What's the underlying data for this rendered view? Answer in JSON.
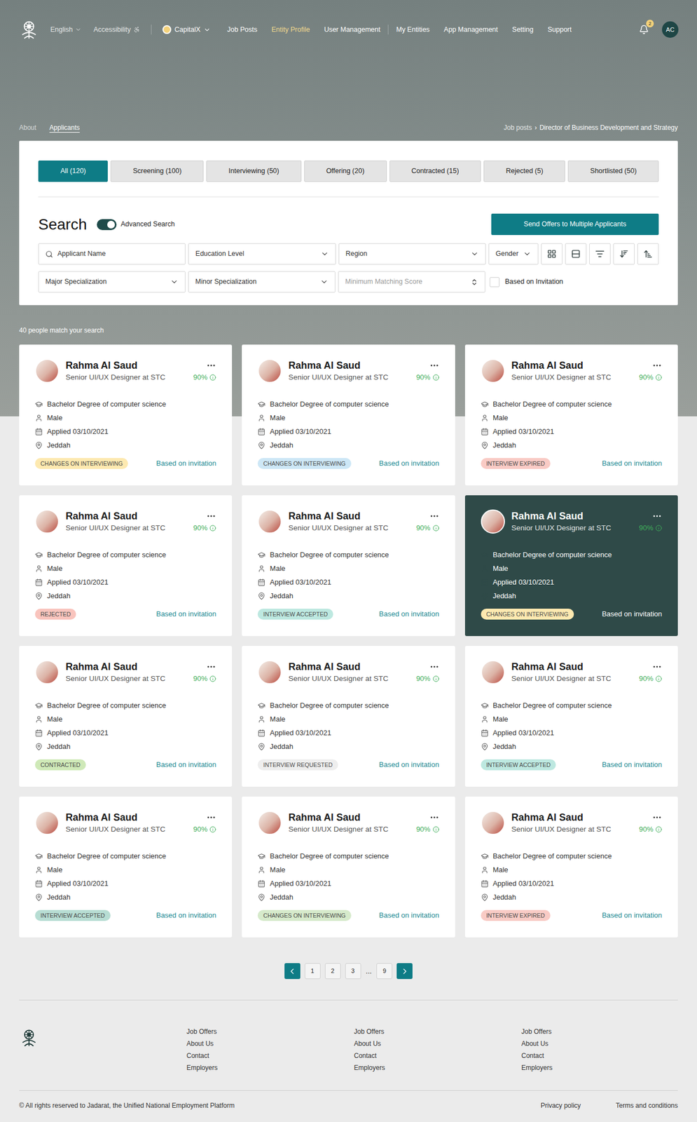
{
  "nav": {
    "language": "English",
    "accessibility": "Accessibility",
    "entity": "CapitalX",
    "entity_items": [
      {
        "label": "Job Posts",
        "selected": false
      },
      {
        "label": "Entity Profile",
        "selected": true
      },
      {
        "label": "User Management",
        "selected": false
      }
    ],
    "account_items": [
      {
        "label": "My Entities",
        "selected": false
      },
      {
        "label": "App Management",
        "selected": false
      },
      {
        "label": "Setting",
        "selected": false
      },
      {
        "label": "Support",
        "selected": false
      }
    ],
    "notifications": "2",
    "avatar": "AC"
  },
  "subnav": [
    {
      "label": "About",
      "selected": false
    },
    {
      "label": "Applicants",
      "selected": true
    }
  ],
  "breadcrumb": {
    "items": [
      "Job posts",
      "Director of Business Development and Strategy"
    ],
    "separator": "›"
  },
  "tabs": [
    {
      "label": "All (120)",
      "selected": true
    },
    {
      "label": "Screening (100)",
      "selected": false
    },
    {
      "label": "Interviewing (50)",
      "selected": false
    },
    {
      "label": "Offering (20)",
      "selected": false
    },
    {
      "label": "Contracted (15)",
      "selected": false
    },
    {
      "label": "Rejected (5)",
      "selected": false
    },
    {
      "label": "Shortlisted (50)",
      "selected": false
    }
  ],
  "search": {
    "title": "Search",
    "advanced": {
      "label": "Advanced Search",
      "on": true
    },
    "send_button": "Send Offers to Multiple Applicants",
    "name_placeholder": "Applicant Name",
    "selects_row1": [
      "Education Level",
      "Region"
    ],
    "gender": "Gender",
    "selects_row2": [
      "Major Specialization",
      "Minor Specialization"
    ],
    "score_placeholder": "Minimum Matching Score",
    "invitation_checkbox": {
      "label": "Based on Invitation",
      "checked": false
    }
  },
  "results_count": "40 people match your search",
  "applicants": [
    {
      "name": "Rahma Al Saud",
      "title": "Senior UI/UX Designer at STC",
      "score": "90%",
      "education": "Bachelor Degree of computer science",
      "gender": "Male",
      "applied": "Applied 03/10/2021",
      "city": "Jeddah",
      "status": "CHANGES ON INTERVIEWING",
      "color": "#fde9b0",
      "invitation": "Based on invitation",
      "selected": false
    },
    {
      "name": "Rahma Al Saud",
      "title": "Senior UI/UX Designer at STC",
      "score": "90%",
      "education": "Bachelor Degree of computer science",
      "gender": "Male",
      "applied": "Applied 03/10/2021",
      "city": "Jeddah",
      "status": "CHANGES ON INTERVIEWING",
      "color": "#cde7f6",
      "invitation": "Based on invitation",
      "selected": false
    },
    {
      "name": "Rahma Al Saud",
      "title": "Senior UI/UX Designer at STC",
      "score": "90%",
      "education": "Bachelor Degree of computer science",
      "gender": "Male",
      "applied": "Applied 03/10/2021",
      "city": "Jeddah",
      "status": "INTERVIEW EXPIRED",
      "color": "#f9cbc5",
      "invitation": "Based on invitation",
      "selected": false
    },
    {
      "name": "Rahma Al Saud",
      "title": "Senior UI/UX Designer at STC",
      "score": "90%",
      "education": "Bachelor Degree of computer science",
      "gender": "Male",
      "applied": "Applied 03/10/2021",
      "city": "Jeddah",
      "status": "REJECTED",
      "color": "#f9c4bd",
      "invitation": "Based on invitation",
      "selected": false
    },
    {
      "name": "Rahma Al Saud",
      "title": "Senior UI/UX Designer at STC",
      "score": "90%",
      "education": "Bachelor Degree of computer science",
      "gender": "Male",
      "applied": "Applied 03/10/2021",
      "city": "Jeddah",
      "status": "INTERVIEW ACCEPTED",
      "color": "#bde8e0",
      "invitation": "Based on invitation",
      "selected": false
    },
    {
      "name": "Rahma Al Saud",
      "title": "Senior UI/UX Designer at STC",
      "score": "90%",
      "education": "Bachelor Degree of computer science",
      "gender": "Male",
      "applied": "Applied 03/10/2021",
      "city": "Jeddah",
      "status": "CHANGES ON INTERVIEWING",
      "color": "#fde9b0",
      "invitation": "Based on invitation",
      "selected": true
    },
    {
      "name": "Rahma Al Saud",
      "title": "Senior UI/UX Designer at STC",
      "score": "90%",
      "education": "Bachelor Degree of computer science",
      "gender": "Male",
      "applied": "Applied 03/10/2021",
      "city": "Jeddah",
      "status": "CONTRACTED",
      "color": "#cfe9b8",
      "invitation": "Based on invitation",
      "selected": false
    },
    {
      "name": "Rahma Al Saud",
      "title": "Senior UI/UX Designer at STC",
      "score": "90%",
      "education": "Bachelor Degree of computer science",
      "gender": "Male",
      "applied": "Applied 03/10/2021",
      "city": "Jeddah",
      "status": "INTERVIEW REQUESTED",
      "color": "#eeeeee",
      "invitation": "Based on invitation",
      "selected": false
    },
    {
      "name": "Rahma Al Saud",
      "title": "Senior UI/UX Designer at STC",
      "score": "90%",
      "education": "Bachelor Degree of computer science",
      "gender": "Male",
      "applied": "Applied 03/10/2021",
      "city": "Jeddah",
      "status": "INTERVIEW ACCEPTED",
      "color": "#bde8e0",
      "invitation": "Based on invitation",
      "selected": false
    },
    {
      "name": "Rahma Al Saud",
      "title": "Senior UI/UX Designer at STC",
      "score": "90%",
      "education": "Bachelor Degree of computer science",
      "gender": "Male",
      "applied": "Applied 03/10/2021",
      "city": "Jeddah",
      "status": "INTERVIEW ACCEPTED",
      "color": "#b7ddd3",
      "invitation": "Based on invitation",
      "selected": false
    },
    {
      "name": "Rahma Al Saud",
      "title": "Senior UI/UX Designer at STC",
      "score": "90%",
      "education": "Bachelor Degree of computer science",
      "gender": "Male",
      "applied": "Applied 03/10/2021",
      "city": "Jeddah",
      "status": "CHANGES ON INTERVIEWING",
      "color": "#d6eacb",
      "invitation": "Based on invitation",
      "selected": false
    },
    {
      "name": "Rahma Al Saud",
      "title": "Senior UI/UX Designer at STC",
      "score": "90%",
      "education": "Bachelor Degree of computer science",
      "gender": "Male",
      "applied": "Applied 03/10/2021",
      "city": "Jeddah",
      "status": "INTERVIEW EXPIRED",
      "color": "#f9cbc5",
      "invitation": "Based on invitation",
      "selected": false
    }
  ],
  "pagination": {
    "pages": [
      {
        "label": "1",
        "kind": "page",
        "selected": false
      },
      {
        "label": "2",
        "kind": "page",
        "selected": false
      },
      {
        "label": "3",
        "kind": "page",
        "selected": false
      },
      {
        "label": "...",
        "kind": "ellipsis",
        "selected": false
      },
      {
        "label": "9",
        "kind": "page",
        "selected": false
      }
    ]
  },
  "footer": {
    "columns": [
      [
        "Job Offers",
        "About Us",
        "Contact",
        "Employers"
      ],
      [
        "Job Offers",
        "About Us",
        "Contact",
        "Employers"
      ],
      [
        "Job Offers",
        "About Us",
        "Contact",
        "Employers"
      ]
    ],
    "copyright": "© All rights reserved to Jadarat, the Unified National Employment Platform",
    "links": [
      "Privacy policy",
      "Terms and conditions"
    ]
  }
}
